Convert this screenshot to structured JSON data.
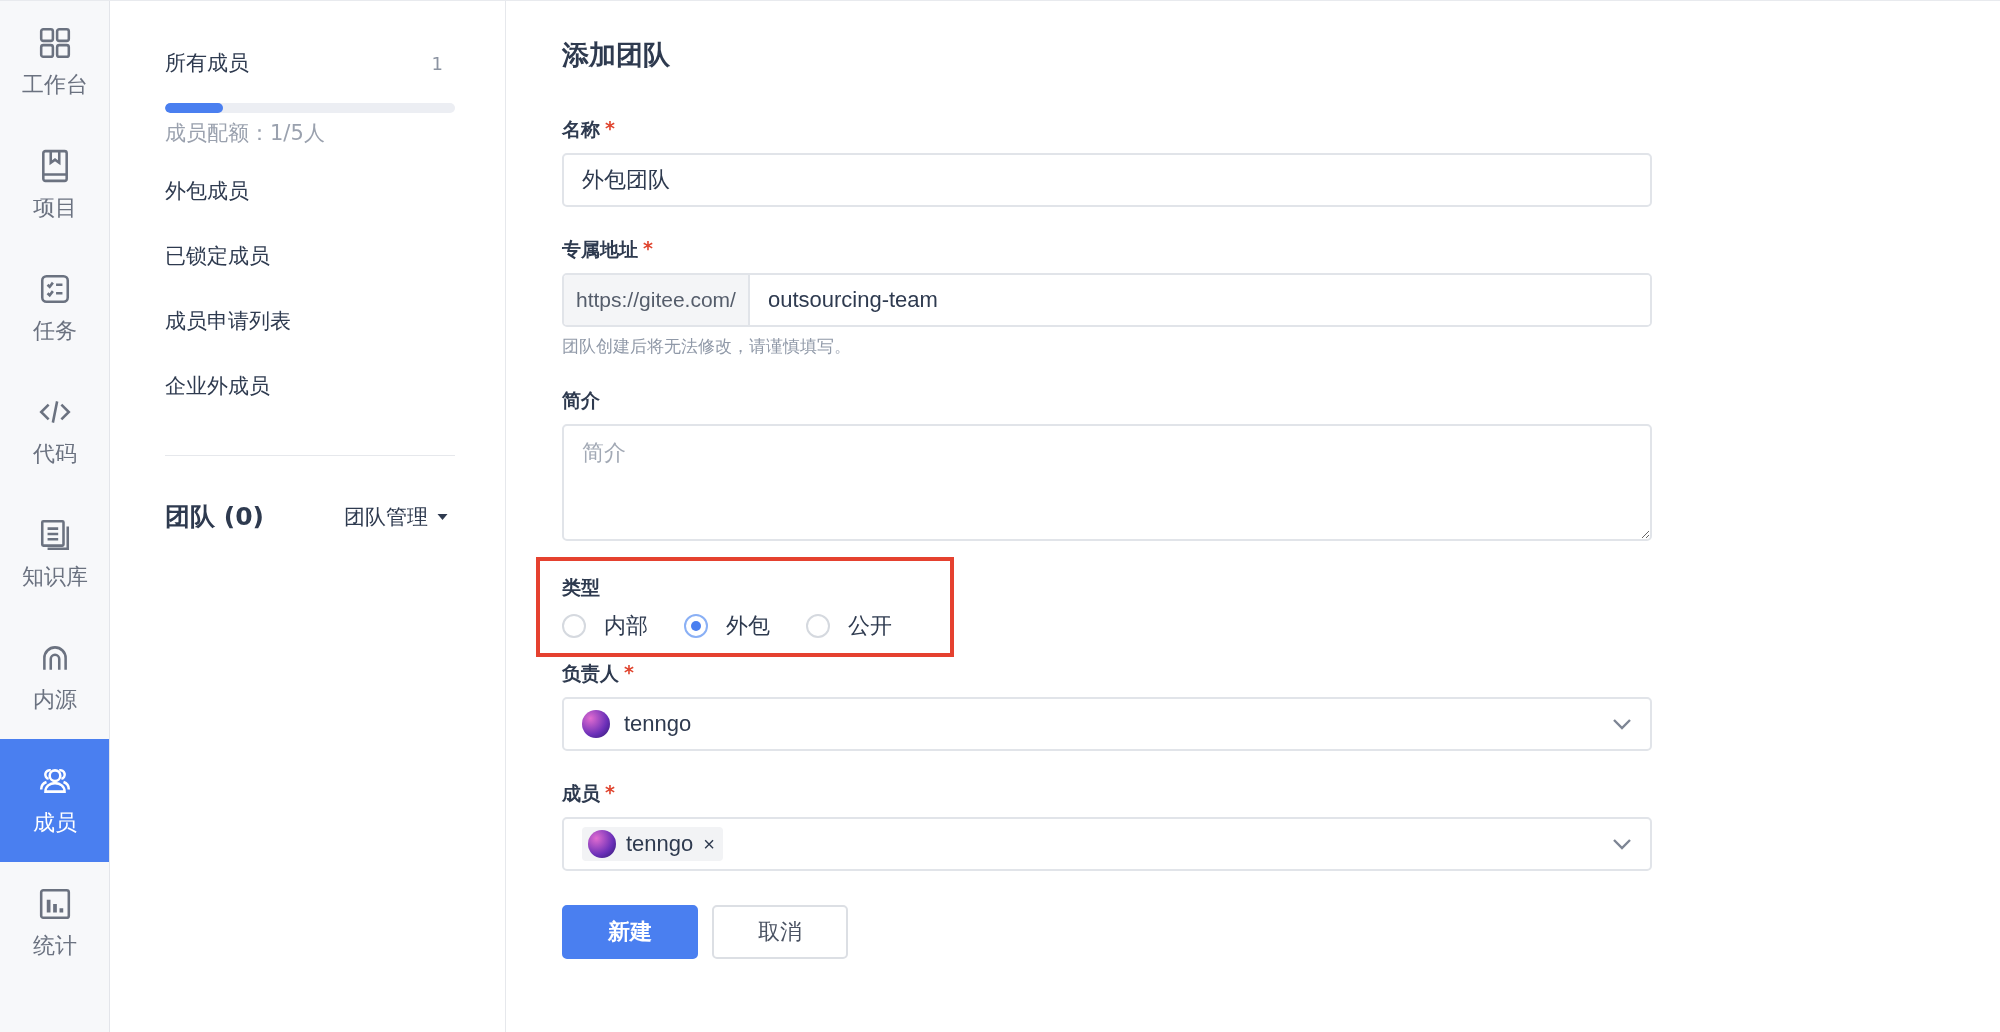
{
  "nav": [
    {
      "label": "工作台",
      "selected": false
    },
    {
      "label": "项目",
      "selected": false
    },
    {
      "label": "任务",
      "selected": false
    },
    {
      "label": "代码",
      "selected": false
    },
    {
      "label": "知识库",
      "selected": false
    },
    {
      "label": "内源",
      "selected": false
    },
    {
      "label": "成员",
      "selected": true
    },
    {
      "label": "统计",
      "selected": false
    }
  ],
  "members_panel": {
    "all": {
      "label": "所有成员",
      "count": "1"
    },
    "quota": {
      "level": 0.2,
      "text": "成员配额：1/5人"
    },
    "items": [
      {
        "label": "外包成员"
      },
      {
        "label": "已锁定成员"
      },
      {
        "label": "成员申请列表"
      },
      {
        "label": "企业外成员"
      }
    ],
    "teams": {
      "title": "团队 (0)",
      "manage": "团队管理"
    }
  },
  "form": {
    "title": "添加团队",
    "fields": [
      {
        "kind": "text",
        "label": "名称",
        "required_mark": "*",
        "value": "外包团队"
      },
      {
        "kind": "prefixed",
        "label": "专属地址",
        "required_mark": "*",
        "prefix": "https://gitee.com/",
        "value": "outsourcing-team",
        "hint": "团队创建后将无法修改，请谨慎填写。"
      },
      {
        "kind": "textarea",
        "label": "简介",
        "placeholder": "简介"
      },
      {
        "kind": "radio",
        "label": "类型",
        "highlighted": true,
        "options": [
          {
            "label": "内部",
            "selected": false
          },
          {
            "label": "外包",
            "selected": true
          },
          {
            "label": "公开",
            "selected": false
          }
        ]
      },
      {
        "kind": "select",
        "label": "负责人",
        "required_mark": "*",
        "value": "tenngo"
      },
      {
        "kind": "tags",
        "label": "成员",
        "required_mark": "*",
        "tags": [
          {
            "label": "tenngo",
            "remove": "×"
          }
        ]
      }
    ],
    "buttons": [
      {
        "label": "新建",
        "kind": "primary"
      },
      {
        "label": "取消",
        "kind": "default"
      }
    ]
  }
}
